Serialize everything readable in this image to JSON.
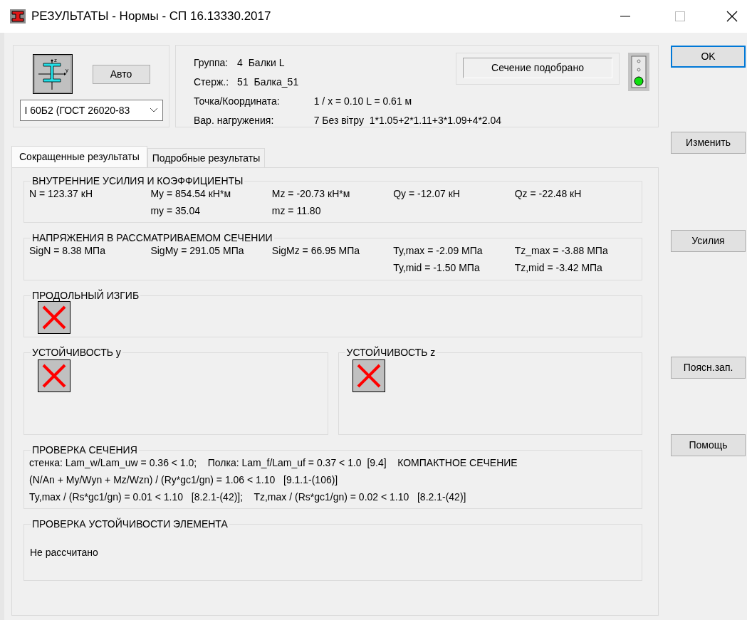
{
  "window": {
    "title": "РЕЗУЛЬТАТЫ - Нормы - СП 16.13330.2017"
  },
  "section": {
    "axis_labels": [
      "z",
      "y"
    ],
    "auto_button": "Авто",
    "profile": {
      "value": "I 60Б2 (ГОСТ 26020-83"
    }
  },
  "info": {
    "identity": [
      {
        "label": "Группа:",
        "value": "4  Балки L"
      },
      {
        "label": "Стерж.:",
        "value": "51  Балка_51"
      }
    ],
    "details": [
      {
        "label": "Точка/Координата:",
        "value": "1 / x = 0.10 L = 0.61 м"
      },
      {
        "label": "Вар. нагружения:",
        "value": "7 Без вітру  1*1.05+2*1.11+3*1.09+4*2.04"
      }
    ]
  },
  "status": {
    "text": "Сечение подобрано",
    "ok": true
  },
  "tabs": [
    {
      "label": "Сокращенные результаты",
      "selected": true
    },
    {
      "label": "Подробные результаты",
      "selected": false
    }
  ],
  "groups": [
    {
      "kind": "values",
      "title": "ВНУТРЕННИЕ УСИЛИЯ И КОЭФФИЦИЕНТЫ",
      "columns": [
        [
          "N = 123.37 кН"
        ],
        [
          "My = 854.54 кН*м",
          "my = 35.04"
        ],
        [
          "Mz = -20.73 кН*м",
          "mz = 11.80"
        ],
        [
          "Qy = -12.07 кН"
        ],
        [
          "Qz = -22.48 кН"
        ]
      ]
    },
    {
      "kind": "values",
      "title": "НАПРЯЖЕНИЯ В РАССМАТРИВАЕМОМ СЕЧЕНИИ",
      "columns": [
        [
          "SigN = 8.38 МПа"
        ],
        [
          "SigMy = 291.05 МПа"
        ],
        [
          "SigMz = 66.95 МПа"
        ],
        [
          "Ty,max = -2.09 МПа",
          "Ty,mid = -1.50 МПа"
        ],
        [
          "Tz_max = -3.88 МПа",
          "Tz,mid = -3.42 МПа"
        ]
      ]
    },
    {
      "kind": "result",
      "title": "ПРОДОЛЬНЫЙ ИЗГИБ",
      "passed": false
    },
    {
      "kind": "pair",
      "items": [
        {
          "title": "УСТОЙЧИВОСТЬ y",
          "passed": false
        },
        {
          "title": "УСТОЙЧИВОСТЬ z",
          "passed": false
        }
      ]
    },
    {
      "kind": "lines",
      "title": "ПРОВЕРКА СЕЧЕНИЯ",
      "lines": [
        "стенка: Lam_w/Lam_uw = 0.36 < 1.0;    Полка: Lam_f/Lam_uf = 0.37 < 1.0  [9.4]    КОМПАКТНОЕ СЕЧЕНИЕ",
        "(N/An + My/Wyn + Mz/Wzn) / (Ry*gc1/gn) = 1.06 < 1.10   [9.1.1-(106)]",
        "Ty,max / (Rs*gc1/gn) = 0.01 < 1.10   [8.2.1-(42)];    Tz,max / (Rs*gc1/gn) = 0.02 < 1.10   [8.2.1-(42)]"
      ]
    },
    {
      "kind": "note",
      "title": "ПРОВЕРКА УСТОЙЧИВОСТИ ЭЛЕМЕНТА",
      "text": "Не рассчитано"
    }
  ],
  "buttons": [
    {
      "label": "OK",
      "default": true
    },
    {
      "label": "Изменить",
      "default": false
    },
    {
      "label": "Усилия",
      "default": false
    },
    {
      "label": "Поясн.зап.",
      "default": false
    },
    {
      "label": "Помощь",
      "default": false
    }
  ]
}
